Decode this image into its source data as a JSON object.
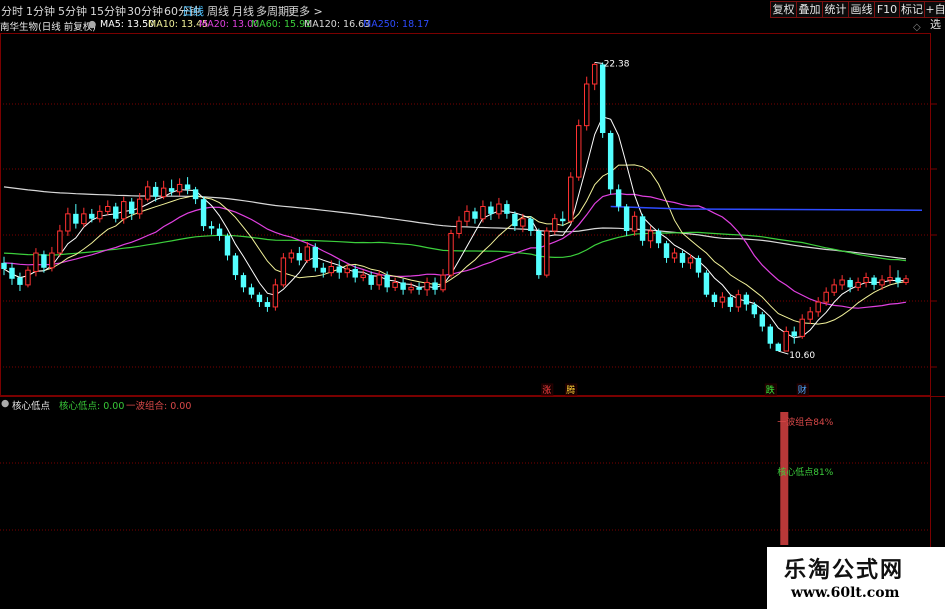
{
  "toolbar": {
    "periods": [
      "分时",
      "1分钟",
      "5分钟",
      "15分钟",
      "30分钟",
      "60分钟",
      "日线",
      "周线",
      "月线",
      "多周期",
      "更多 >"
    ],
    "active_period": "日线",
    "buttons": [
      "复权",
      "叠加",
      "统计",
      "画线",
      "F10",
      "标记",
      "+自选"
    ]
  },
  "legend": {
    "stock_title": "南华生物(日线 前复权)",
    "ma_items": [
      {
        "text": "MA5: 13.50",
        "color": "#ffffff"
      },
      {
        "text": "MA10: 13.45",
        "color": "#f2f29a"
      },
      {
        "text": "MA20: 13.00",
        "color": "#e040e0"
      },
      {
        "text": "MA60: 15.91",
        "color": "#3ccf3c"
      },
      {
        "text": "MA120: 16.63",
        "color": "#d8d8d8"
      },
      {
        "text": "MA250: 18.17",
        "color": "#2d4bff"
      }
    ]
  },
  "sub_legend": {
    "title": "核心低点",
    "items": [
      {
        "text": "核心低点: 0.00",
        "color": "#38c838"
      },
      {
        "text": "一波组合: 0.00",
        "color": "#d84848"
      }
    ]
  },
  "colors": {
    "up": "#ff3232",
    "down": "#54ffff",
    "grid": "#7a0000",
    "ma5": "#ffffff",
    "ma10": "#f2f29a",
    "ma20": "#e040e0",
    "ma60": "#3ccf3c",
    "ma120": "#d8d8d8",
    "ma250": "#2d4bff",
    "bar": "#b83838"
  },
  "chart_data": {
    "type": "candlestick",
    "ylim": [
      9.5,
      23.5
    ],
    "candles": [
      [
        14.2,
        13.95,
        14.45,
        13.7
      ],
      [
        14.0,
        13.55,
        14.2,
        13.3
      ],
      [
        13.6,
        13.3,
        13.8,
        13.05
      ],
      [
        13.3,
        13.9,
        14.05,
        13.2
      ],
      [
        13.85,
        14.6,
        14.8,
        13.65
      ],
      [
        14.55,
        14.0,
        14.7,
        13.8
      ],
      [
        14.0,
        14.6,
        14.85,
        13.85
      ],
      [
        14.6,
        15.5,
        15.75,
        14.45
      ],
      [
        15.5,
        16.2,
        16.45,
        15.3
      ],
      [
        16.2,
        15.8,
        16.6,
        15.6
      ],
      [
        15.8,
        16.2,
        16.45,
        15.65
      ],
      [
        16.2,
        16.0,
        16.4,
        15.85
      ],
      [
        16.0,
        16.3,
        16.55,
        15.85
      ],
      [
        16.3,
        16.5,
        16.75,
        16.15
      ],
      [
        16.5,
        16.0,
        16.65,
        15.85
      ],
      [
        16.0,
        16.7,
        16.9,
        15.8
      ],
      [
        16.7,
        16.2,
        16.85,
        15.95
      ],
      [
        16.2,
        16.8,
        17.05,
        16.0
      ],
      [
        16.8,
        17.3,
        17.55,
        16.7
      ],
      [
        17.3,
        16.9,
        17.5,
        16.7
      ],
      [
        16.9,
        17.25,
        17.55,
        16.8
      ],
      [
        17.25,
        17.1,
        17.6,
        16.95
      ],
      [
        17.1,
        17.4,
        17.65,
        16.95
      ],
      [
        17.4,
        17.2,
        17.7,
        17.0
      ],
      [
        17.2,
        16.8,
        17.3,
        16.6
      ],
      [
        16.8,
        15.7,
        16.9,
        15.5
      ],
      [
        15.7,
        15.6,
        15.9,
        15.35
      ],
      [
        15.6,
        15.3,
        15.8,
        15.1
      ],
      [
        15.3,
        14.5,
        15.4,
        14.3
      ],
      [
        14.5,
        13.7,
        14.6,
        13.5
      ],
      [
        13.7,
        13.2,
        13.8,
        13.0
      ],
      [
        13.2,
        12.9,
        13.35,
        12.75
      ],
      [
        12.9,
        12.6,
        13.0,
        12.4
      ],
      [
        12.6,
        12.4,
        12.8,
        12.2
      ],
      [
        12.4,
        13.3,
        13.55,
        12.25
      ],
      [
        13.3,
        14.4,
        14.6,
        13.2
      ],
      [
        14.4,
        14.6,
        14.75,
        14.2
      ],
      [
        14.6,
        14.3,
        14.85,
        14.1
      ],
      [
        14.3,
        14.85,
        15.05,
        14.2
      ],
      [
        14.85,
        14.0,
        15.0,
        13.85
      ],
      [
        14.0,
        13.8,
        14.2,
        13.6
      ],
      [
        13.8,
        14.05,
        14.3,
        13.65
      ],
      [
        14.05,
        13.8,
        14.3,
        13.55
      ],
      [
        13.8,
        13.95,
        14.15,
        13.6
      ],
      [
        13.95,
        13.6,
        14.1,
        13.4
      ],
      [
        13.6,
        13.7,
        13.9,
        13.45
      ],
      [
        13.7,
        13.3,
        13.85,
        13.1
      ],
      [
        13.3,
        13.7,
        13.9,
        13.1
      ],
      [
        13.7,
        13.2,
        13.85,
        13.0
      ],
      [
        13.2,
        13.4,
        13.6,
        13.05
      ],
      [
        13.4,
        13.1,
        13.55,
        12.9
      ],
      [
        13.1,
        13.2,
        13.4,
        12.95
      ],
      [
        13.2,
        13.1,
        13.4,
        12.9
      ],
      [
        13.1,
        13.4,
        13.6,
        12.85
      ],
      [
        13.4,
        13.1,
        13.6,
        12.9
      ],
      [
        13.1,
        13.7,
        13.95,
        13.0
      ],
      [
        13.7,
        15.4,
        15.55,
        13.6
      ],
      [
        15.4,
        15.9,
        16.1,
        15.2
      ],
      [
        15.9,
        16.3,
        16.55,
        15.7
      ],
      [
        16.3,
        16.0,
        16.45,
        15.8
      ],
      [
        16.0,
        16.5,
        16.75,
        15.85
      ],
      [
        16.5,
        16.2,
        16.7,
        15.95
      ],
      [
        16.2,
        16.6,
        16.85,
        16.0
      ],
      [
        16.6,
        16.2,
        16.75,
        16.0
      ],
      [
        16.2,
        15.7,
        16.3,
        15.5
      ],
      [
        15.7,
        16.0,
        16.2,
        15.45
      ],
      [
        16.0,
        15.5,
        16.1,
        15.3
      ],
      [
        15.5,
        13.7,
        15.6,
        13.55
      ],
      [
        13.7,
        15.5,
        15.65,
        13.6
      ],
      [
        15.5,
        16.0,
        16.2,
        15.35
      ],
      [
        16.0,
        15.9,
        16.3,
        15.7
      ],
      [
        15.9,
        17.7,
        17.9,
        15.8
      ],
      [
        17.7,
        19.8,
        20.05,
        17.55
      ],
      [
        19.8,
        21.5,
        21.8,
        19.6
      ],
      [
        21.5,
        22.3,
        22.38,
        21.25
      ],
      [
        22.3,
        19.5,
        22.38,
        19.3
      ],
      [
        19.5,
        17.2,
        19.6,
        17.0
      ],
      [
        17.2,
        16.5,
        17.4,
        16.3
      ],
      [
        16.5,
        15.5,
        16.6,
        15.3
      ],
      [
        15.5,
        16.1,
        16.3,
        15.3
      ],
      [
        16.1,
        15.1,
        16.2,
        14.9
      ],
      [
        15.1,
        15.5,
        15.7,
        14.8
      ],
      [
        15.5,
        15.0,
        15.6,
        14.8
      ],
      [
        15.0,
        14.4,
        15.1,
        14.2
      ],
      [
        14.4,
        14.6,
        14.8,
        14.2
      ],
      [
        14.6,
        14.2,
        14.7,
        14.0
      ],
      [
        14.2,
        14.4,
        14.55,
        13.95
      ],
      [
        14.4,
        13.8,
        14.5,
        13.6
      ],
      [
        13.8,
        12.9,
        13.9,
        12.8
      ],
      [
        12.9,
        12.6,
        13.0,
        12.4
      ],
      [
        12.6,
        12.8,
        13.0,
        12.35
      ],
      [
        12.8,
        12.4,
        12.9,
        12.2
      ],
      [
        12.4,
        12.9,
        13.1,
        12.2
      ],
      [
        12.9,
        12.5,
        13.0,
        12.25
      ],
      [
        12.5,
        12.1,
        12.6,
        11.95
      ],
      [
        12.1,
        11.6,
        12.2,
        11.4
      ],
      [
        11.6,
        10.9,
        11.7,
        10.7
      ],
      [
        10.9,
        10.6,
        10.95,
        10.6
      ],
      [
        10.6,
        11.4,
        11.6,
        10.6
      ],
      [
        11.4,
        11.2,
        11.6,
        10.9
      ],
      [
        11.2,
        11.9,
        12.1,
        11.1
      ],
      [
        11.9,
        12.2,
        12.4,
        11.7
      ],
      [
        12.2,
        12.6,
        12.8,
        12.0
      ],
      [
        12.6,
        13.0,
        13.2,
        12.45
      ],
      [
        13.0,
        13.3,
        13.55,
        12.85
      ],
      [
        13.3,
        13.5,
        13.7,
        13.1
      ],
      [
        13.5,
        13.2,
        13.6,
        13.0
      ],
      [
        13.2,
        13.4,
        13.6,
        13.05
      ],
      [
        13.4,
        13.6,
        13.8,
        13.2
      ],
      [
        13.6,
        13.3,
        13.7,
        13.1
      ],
      [
        13.3,
        13.5,
        13.7,
        13.1
      ],
      [
        13.5,
        13.6,
        14.1,
        13.35
      ],
      [
        13.6,
        13.4,
        13.9,
        13.2
      ],
      [
        13.4,
        13.55,
        13.7,
        13.3
      ]
    ],
    "ma250": [
      {
        "x": 76,
        "y": 16.5
      },
      {
        "x": 85,
        "y": 16.4
      },
      {
        "x": 115,
        "y": 16.35
      }
    ],
    "annotations": [
      {
        "label": "22.38",
        "at": "high",
        "color": "#ffffff"
      },
      {
        "label": "10.60",
        "at": "low",
        "color": "#ffffff"
      },
      {
        "label": "涨",
        "color": "#ff4040",
        "index": 68
      },
      {
        "label": "腾",
        "color": "#ffcc33",
        "index": 71
      },
      {
        "label": "跌",
        "color": "#3cf03c",
        "index": 96
      },
      {
        "label": "财",
        "color": "#4fa8ff",
        "index": 100
      }
    ],
    "indicator": {
      "bar_index": 97,
      "value": 1.0,
      "labels": [
        {
          "text": "一波组合84%",
          "color": "#d84848",
          "pos": 0.84
        },
        {
          "text": "核心低点81%",
          "color": "#3ccf3c",
          "pos": 0.81
        }
      ]
    }
  },
  "watermark": {
    "title": "乐淘公式网",
    "url": "www.60lt.com"
  }
}
